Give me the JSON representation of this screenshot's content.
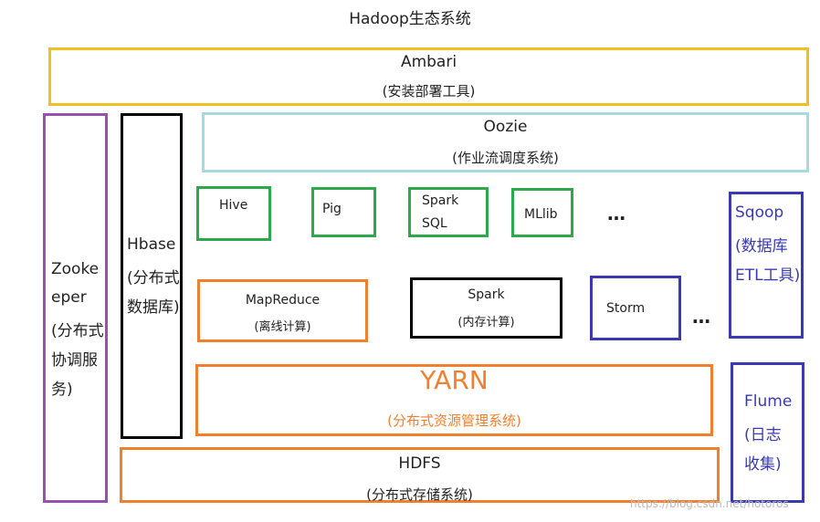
{
  "title": "Hadoop生态系统",
  "ambari": {
    "name": "Ambari",
    "desc": "(安装部署工具)",
    "color": "#f0c020"
  },
  "oozie": {
    "name": "Oozie",
    "desc": "(作业流调度系统)",
    "color": "#a8d8e0"
  },
  "zookeeper": {
    "line1": "Zooke",
    "line2": "eper",
    "line3": "(分布式",
    "line4": "协调服",
    "line5": "务)",
    "color": "#9b4fb0"
  },
  "hbase": {
    "line1": "Hbase",
    "line2": "(分布式",
    "line3": "数据库)",
    "color": "#000000"
  },
  "analytics": {
    "hive": "Hive",
    "pig": "Pig",
    "spark_sql_line1": "Spark",
    "spark_sql_line2": "SQL",
    "mllib": "MLlib",
    "more": "…",
    "color": "#2ea84a"
  },
  "compute": {
    "mapreduce": {
      "name": "MapReduce",
      "desc": "(离线计算)",
      "color": "#f08030"
    },
    "spark": {
      "name": "Spark",
      "desc": "(内存计算)",
      "color": "#000000"
    },
    "storm": {
      "name": "Storm",
      "color": "#3a3ab0"
    },
    "more": "…"
  },
  "yarn": {
    "name": "YARN",
    "desc": "(分布式资源管理系统)",
    "color": "#f08030"
  },
  "hdfs": {
    "name": "HDFS",
    "desc": "(分布式存储系统)",
    "color": "#f08030"
  },
  "sqoop": {
    "line1": "Sqoop",
    "line2": "(数据库",
    "line3": "ETL工具)",
    "color": "#3a3ab0"
  },
  "flume": {
    "line1": "Flume",
    "line2": "(日志",
    "line3": "收集)",
    "color": "#3a3ab0"
  },
  "watermark": "https://blog.csdn.net/hotoros"
}
